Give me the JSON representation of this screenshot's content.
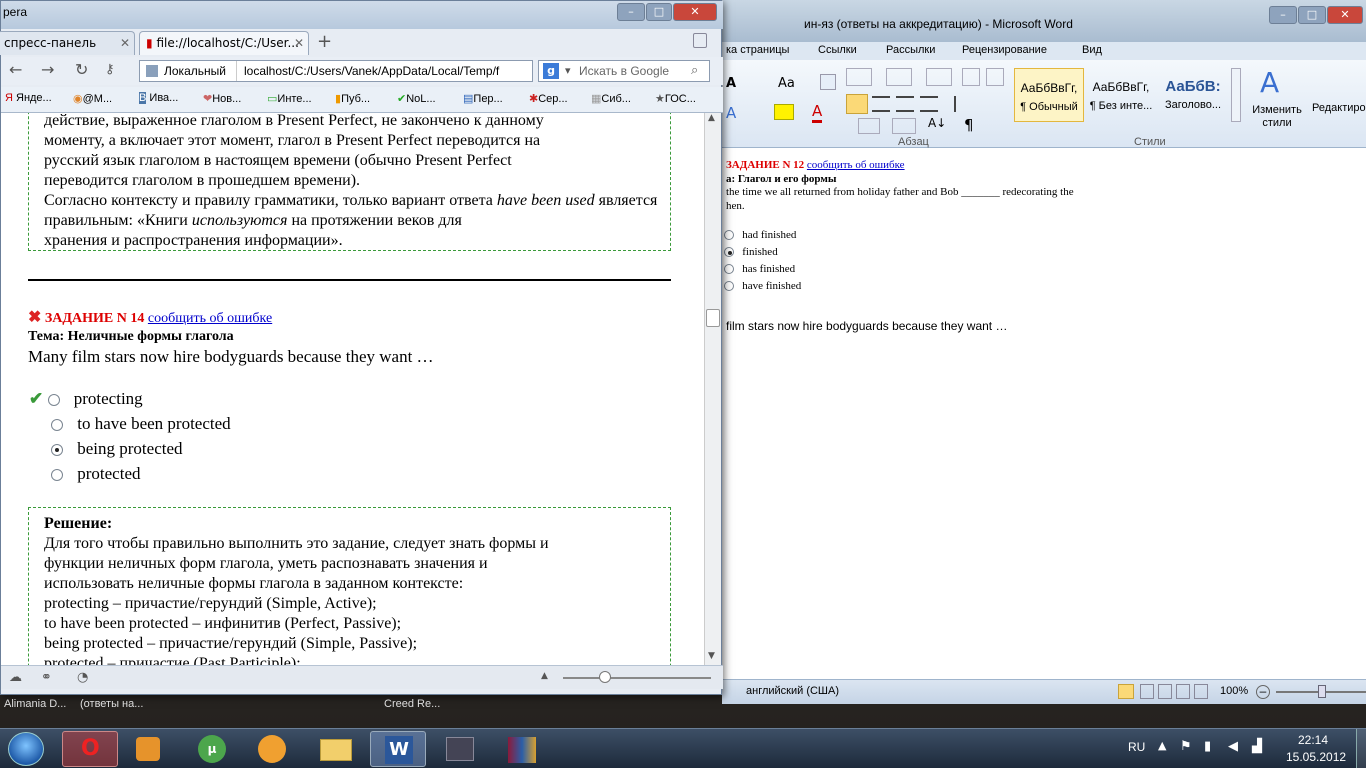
{
  "browser": {
    "title_partial": "pera",
    "tabs": [
      {
        "label": "спресс-панель"
      },
      {
        "label": "file://localhost/C:/User..."
      }
    ],
    "address_label": "Локальный",
    "address": "localhost/C:/Users/Vanek/AppData/Local/Temp/f",
    "search_placeholder": "Искать в Google",
    "bookmarks": [
      "Янде...",
      "@M...",
      "Ива...",
      "Нов...",
      "Инте...",
      "Пуб...",
      "NoL...",
      "Пер...",
      "Сер...",
      "Сиб...",
      "ГОС..."
    ],
    "page": {
      "prev_text": [
        "действие, выраженное глаголом в Present Perfect, не закончено к данному",
        "моменту, а включает этот момент, глагол в Present Perfect переводится на",
        "русский язык глаголом в настоящем времени (обычно Present Perfect",
        "переводится глаголом в прошедшем времени)."
      ],
      "prev_conclusion_a": "Согласно контексту и правилу грамматики, только вариант ответа ",
      "prev_conclusion_em": "have been used",
      "prev_conclusion_b": " является правильным: «Книги ",
      "prev_conclusion_em2": "используются",
      "prev_conclusion_c": " на протяжении веков для",
      "prev_conclusion_d": "хранения и распространения информации».",
      "task_label": "ЗАДАНИЕ N 14",
      "report_link": "сообщить об ошибке",
      "topic": "Тема: Неличные формы глагола",
      "question": "Many film stars now hire bodyguards because they want …",
      "options": [
        {
          "label": "protecting",
          "selected": false,
          "correct": true
        },
        {
          "label": "to have been protected",
          "selected": false,
          "correct": false
        },
        {
          "label": "being protected",
          "selected": true,
          "correct": false
        },
        {
          "label": "protected",
          "selected": false,
          "correct": false
        }
      ],
      "solution_title": "Решение:",
      "solution_lines": [
        "Для того чтобы правильно выполнить это задание, следует знать формы и",
        "функции неличных форм глагола, уметь распознавать значения и",
        "использовать неличные формы глагола в заданном контексте:",
        "protecting – причастие/герундий (Simple, Active);",
        "to have been protected – инфинитив (Perfect, Passive);",
        "being protected – причастие/герундий (Simple, Passive);",
        "protected – причастие (Past Participle);"
      ]
    }
  },
  "word": {
    "title": "ин-яз (ответы на аккредитацию)  -  Microsoft Word",
    "tabs": [
      "ка страницы",
      "Ссылки",
      "Рассылки",
      "Рецензирование",
      "Вид"
    ],
    "groups": {
      "paragraph": "Абзац",
      "styles": "Стили"
    },
    "styles": [
      {
        "preview": "АаБбВвГг,",
        "name": "¶ Обычный"
      },
      {
        "preview": "АаБбВвГг,",
        "name": "¶ Без инте..."
      },
      {
        "preview": "АаБбВ:",
        "name": "Заголово..."
      }
    ],
    "change_styles": "Изменить стили",
    "editing": "Редактиров",
    "doc": {
      "task_label": "ЗАДАНИЕ N 12",
      "report_link": "сообщить об ошибке",
      "topic": "а: Глагол и его формы",
      "question_l1": "the time we all returned from holiday father and Bob _______ redecorating the",
      "question_l2": "hen.",
      "options": [
        {
          "label": "had finished",
          "selected": false
        },
        {
          "label": "finished",
          "selected": true
        },
        {
          "label": "has finished",
          "selected": false
        },
        {
          "label": "have finished",
          "selected": false
        }
      ],
      "next_question": "film stars now hire bodyguards because they want …"
    },
    "status": {
      "language": "английский (США)",
      "zoom": "100%"
    }
  },
  "tasklabels": [
    "Alimania D...",
    "(ответы на...",
    "Creed Re..."
  ],
  "taskbar": {
    "lang": "RU",
    "time": "22:14",
    "date": "15.05.2012"
  }
}
